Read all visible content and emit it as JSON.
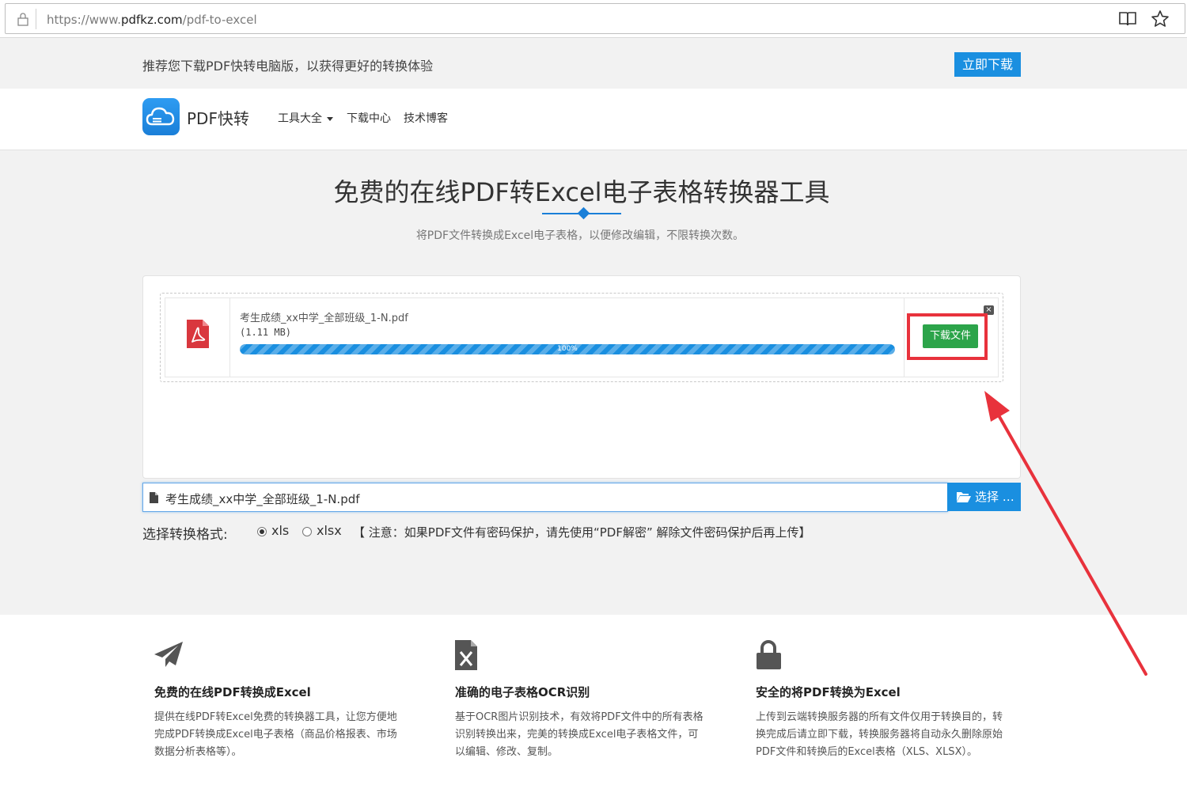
{
  "browser": {
    "url_prefix": "https://www.",
    "url_domain": "pdfkz.com",
    "url_path": "/pdf-to-excel"
  },
  "promo": {
    "text": "推荐您下载PDF快转电脑版，以获得更好的转换体验",
    "button": "立即下载"
  },
  "nav": {
    "brand": "PDF快转",
    "items": [
      "工具大全",
      "下载中心",
      "技术博客"
    ]
  },
  "hero": {
    "title": "免费的在线PDF转Excel电子表格转换器工具",
    "subtitle": "将PDF文件转换成Excel电子表格，以便修改编辑，不限转换次数。"
  },
  "upload": {
    "file_name": "考生成绩_xx中学_全部班级_1-N.pdf",
    "file_size": "(1.11 MB)",
    "progress": 100,
    "progress_label": "100%",
    "close": "×",
    "download_button": "下载文件",
    "input_value": "考生成绩_xx中学_全部班级_1-N.pdf",
    "choose_button": "选择 …"
  },
  "format": {
    "label": "选择转换格式:",
    "options": [
      {
        "label": "xls",
        "selected": true
      },
      {
        "label": "xlsx",
        "selected": false
      }
    ],
    "notice": "【 注意：如果PDF文件有密码保护，请先使用“PDF解密” 解除文件密码保护后再上传】"
  },
  "features": [
    {
      "icon": "paper-plane-icon",
      "title": "免费的在线PDF转换成Excel",
      "text": "提供在线PDF转Excel免费的转换器工具，让您方便地完成PDF转换成Excel电子表格（商品价格报表、市场数据分析表格等）。"
    },
    {
      "icon": "excel-file-icon",
      "title": "准确的电子表格OCR识别",
      "text": "基于OCR图片识别技术，有效将PDF文件中的所有表格识别转换出来，完美的转换成Excel电子表格文件，可以编辑、修改、复制。"
    },
    {
      "icon": "lock-icon",
      "title": "安全的将PDF转换为Excel",
      "text": "上传到云端转换服务器的所有文件仅用于转换目的，转换完成后请立即下载，转换服务器将自动永久删除原始PDF文件和转换后的Excel表格（XLS、XLSX）。"
    }
  ],
  "colors": {
    "primary": "#1a8fe0",
    "download_green": "#2ca44a",
    "annotation_red": "#e8323c"
  }
}
